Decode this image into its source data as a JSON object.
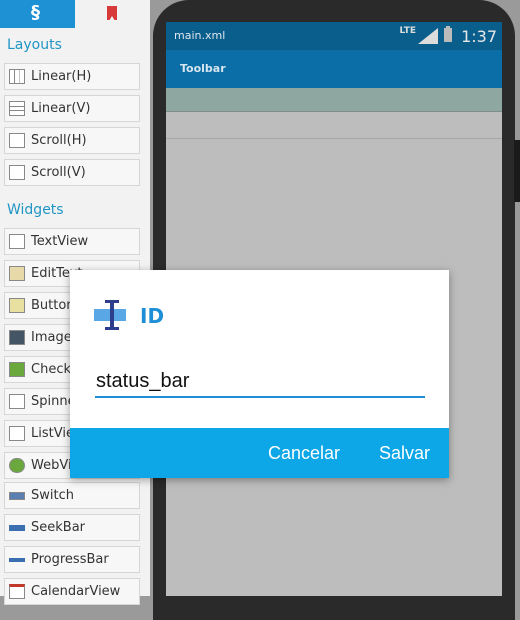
{
  "palette": {
    "tabs": [
      {
        "icon": "palette-icon"
      },
      {
        "icon": "bookmark-icon"
      }
    ],
    "layouts_label": "Layouts",
    "layouts": [
      {
        "label": "Linear(H)",
        "icon": "linear-horizontal-icon"
      },
      {
        "label": "Linear(V)",
        "icon": "linear-vertical-icon"
      },
      {
        "label": "Scroll(H)",
        "icon": "scroll-horizontal-icon"
      },
      {
        "label": "Scroll(V)",
        "icon": "scroll-vertical-icon"
      }
    ],
    "widgets_label": "Widgets",
    "widgets": [
      {
        "label": "TextView",
        "icon": "textview-icon"
      },
      {
        "label": "EditText",
        "icon": "edittext-icon"
      },
      {
        "label": "Button",
        "icon": "button-icon"
      },
      {
        "label": "ImageView",
        "icon": "imageview-icon"
      },
      {
        "label": "CheckBox",
        "icon": "checkbox-icon"
      },
      {
        "label": "Spinner",
        "icon": "spinner-icon"
      },
      {
        "label": "ListView",
        "icon": "listview-icon"
      },
      {
        "label": "WebView",
        "icon": "webview-icon"
      },
      {
        "label": "Switch",
        "icon": "switch-icon"
      },
      {
        "label": "SeekBar",
        "icon": "seekbar-icon"
      },
      {
        "label": "ProgressBar",
        "icon": "progressbar-icon"
      },
      {
        "label": "CalendarView",
        "icon": "calendarview-icon"
      }
    ]
  },
  "phone": {
    "status_file": "main.xml",
    "status_time": "1:37",
    "status_icons": [
      "lte-icon",
      "signal-icon",
      "battery-icon"
    ],
    "toolbar_title": "Toolbar"
  },
  "dialog": {
    "title": "ID",
    "input_value": "status_bar",
    "cancel_label": "Cancelar",
    "save_label": "Salvar",
    "accent": "#1e8fd6",
    "button_bar_color": "#0da6e6"
  }
}
